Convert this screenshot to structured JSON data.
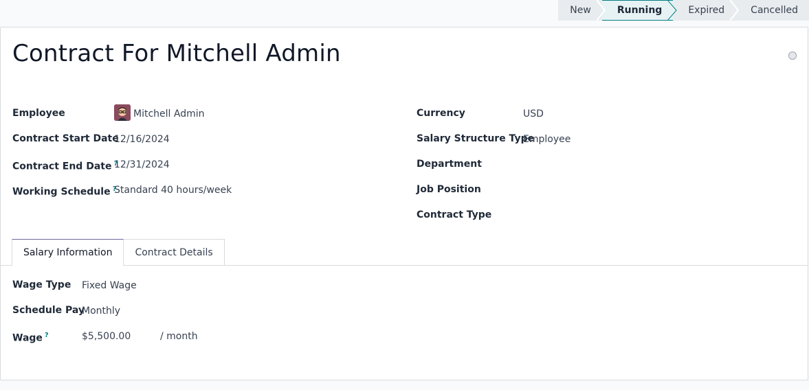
{
  "statusbar": {
    "stages": [
      {
        "label": "New",
        "active": false
      },
      {
        "label": "Running",
        "active": true
      },
      {
        "label": "Expired",
        "active": false
      },
      {
        "label": "Cancelled",
        "active": false
      }
    ]
  },
  "record": {
    "title": "Contract For Mitchell Admin"
  },
  "left_fields": {
    "employee": {
      "label": "Employee",
      "value": "Mitchell Admin"
    },
    "start_date": {
      "label": "Contract Start Date",
      "value": "12/16/2024"
    },
    "end_date": {
      "label": "Contract End Date",
      "value": "12/31/2024",
      "help": "?"
    },
    "working_schedule": {
      "label": "Working Schedule",
      "value": "Standard 40 hours/week",
      "help": "?"
    }
  },
  "right_fields": {
    "currency": {
      "label": "Currency",
      "value": "USD"
    },
    "structure_type": {
      "label": "Salary Structure Type",
      "value": "Employee"
    },
    "department": {
      "label": "Department",
      "value": ""
    },
    "job_position": {
      "label": "Job Position",
      "value": ""
    },
    "contract_type": {
      "label": "Contract Type",
      "value": ""
    }
  },
  "tabs": [
    {
      "label": "Salary Information",
      "active": true
    },
    {
      "label": "Contract Details",
      "active": false
    }
  ],
  "salary": {
    "wage_type": {
      "label": "Wage Type",
      "value": "Fixed Wage"
    },
    "schedule_pay": {
      "label": "Schedule Pay",
      "value": "Monthly"
    },
    "wage": {
      "label": "Wage",
      "value": "$5,500.00",
      "unit": "/ month",
      "help": "?"
    }
  },
  "colors": {
    "accent": "#017e84",
    "tab_accent": "#71639e",
    "avatar_bg": "#8b4a5e"
  },
  "icons": {
    "avatar": "employee-avatar",
    "state": "status-circle-icon"
  }
}
